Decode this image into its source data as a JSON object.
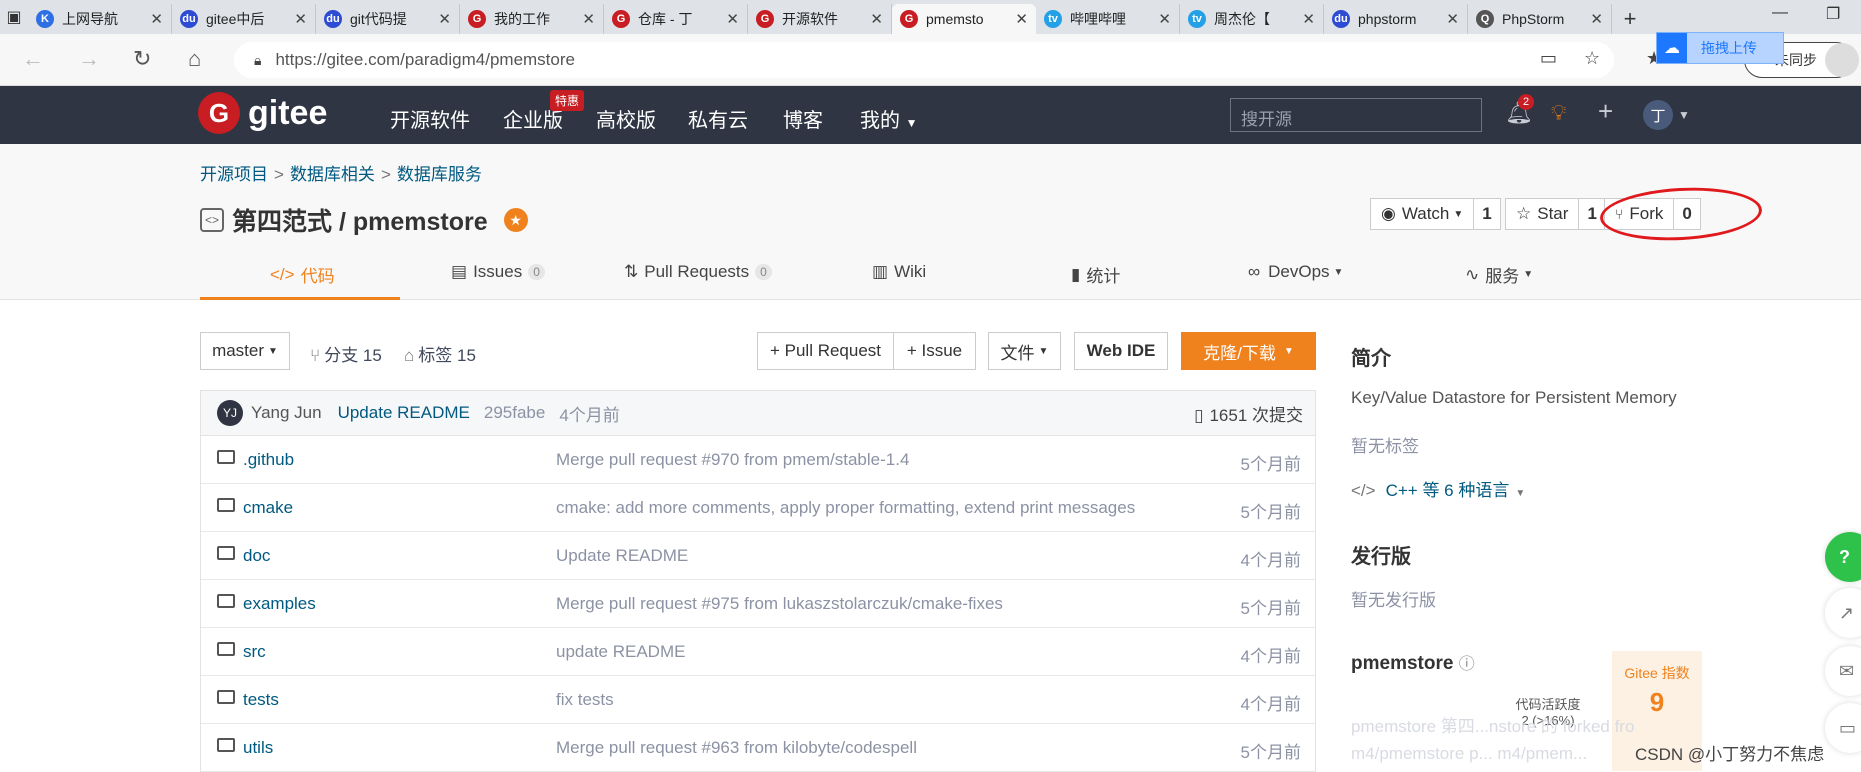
{
  "browser": {
    "tabs": [
      {
        "title": "上网导航",
        "fav": "K",
        "color": "#2f6fe4"
      },
      {
        "title": "gitee中后",
        "fav": "du",
        "color": "#2e4bd4"
      },
      {
        "title": "git代码提",
        "fav": "du",
        "color": "#2e4bd4"
      },
      {
        "title": "我的工作",
        "fav": "G",
        "color": "#c71d23"
      },
      {
        "title": "仓库 - 丁",
        "fav": "G",
        "color": "#c71d23"
      },
      {
        "title": "开源软件",
        "fav": "G",
        "color": "#c71d23"
      },
      {
        "title": "pmemsto",
        "fav": "G",
        "color": "#c71d23",
        "active": true
      },
      {
        "title": "哔哩哔哩",
        "fav": "tv",
        "color": "#23a0e6"
      },
      {
        "title": "周杰伦【",
        "fav": "tv",
        "color": "#23a0e6"
      },
      {
        "title": "phpstorm",
        "fav": "du",
        "color": "#2e4bd4"
      },
      {
        "title": "PhpStorm",
        "fav": "Q",
        "color": "#555555"
      }
    ],
    "url": "https://gitee.com/paradigm4/pmemstore",
    "sync_label": "未同步",
    "upload_label": "拖拽上传"
  },
  "gitee_nav": {
    "logo": "gitee",
    "items": [
      "开源软件",
      "企业版",
      "高校版",
      "私有云",
      "博客",
      "我的"
    ],
    "hot_badge": "特惠",
    "search_placeholder": "搜开源",
    "notif_count": "2",
    "user_initial": "丁"
  },
  "project": {
    "breadcrumb": [
      "开源项目",
      "数据库相关",
      "数据库服务"
    ],
    "title": "第四范式 / pmemstore",
    "watch": {
      "label": "Watch",
      "count": "1"
    },
    "star": {
      "label": "Star",
      "count": "1"
    },
    "fork": {
      "label": "Fork",
      "count": "0"
    },
    "tabs": [
      {
        "label": "代码"
      },
      {
        "label": "Issues",
        "count": "0"
      },
      {
        "label": "Pull Requests",
        "count": "0"
      },
      {
        "label": "Wiki"
      },
      {
        "label": "统计"
      },
      {
        "label": "DevOps"
      },
      {
        "label": "服务"
      }
    ]
  },
  "toolbar": {
    "branch": "master",
    "branches": "分支 15",
    "tags": "标签 15",
    "pull_request": "+ Pull Request",
    "issue": "+ Issue",
    "file": "文件",
    "web_ide": "Web IDE",
    "clone": "克隆/下载"
  },
  "commit": {
    "avatar": "YJ",
    "author": "Yang Jun",
    "message": "Update README",
    "hash": "295fabe",
    "time": "4个月前",
    "count": "1651 次提交"
  },
  "files": [
    {
      "name": ".github",
      "msg": "Merge pull request #970 from pmem/stable-1.4",
      "time": "5个月前"
    },
    {
      "name": "cmake",
      "msg": "cmake: add more comments, apply proper formatting, extend print messages",
      "time": "5个月前"
    },
    {
      "name": "doc",
      "msg": "Update README",
      "time": "4个月前"
    },
    {
      "name": "examples",
      "msg": "Merge pull request #975 from lukaszstolarczuk/cmake-fixes",
      "time": "5个月前"
    },
    {
      "name": "src",
      "msg": "update README",
      "time": "4个月前"
    },
    {
      "name": "tests",
      "msg": "fix tests",
      "time": "4个月前"
    },
    {
      "name": "utils",
      "msg": "Merge pull request #963 from kilobyte/codespell",
      "time": "5个月前"
    }
  ],
  "sidebar": {
    "intro_title": "简介",
    "description": "Key/Value Datastore for Persistent Memory",
    "no_tags": "暂无标签",
    "languages": "C++ 等 6 种语言",
    "release_title": "发行版",
    "no_release": "暂无发行版",
    "repo_name": "pmemstore",
    "gitee_index_label": "Gitee 指数",
    "gitee_index_value": "9",
    "activity_label": "代码活跃度",
    "activity_value": "2 (>16%)",
    "faded_1": "pmemstore 第四...nstore 的 forked fro",
    "faded_2": "m4/pmemstore p... m4/pmem..."
  },
  "watermark": "CSDN @小丁努力不焦虑"
}
